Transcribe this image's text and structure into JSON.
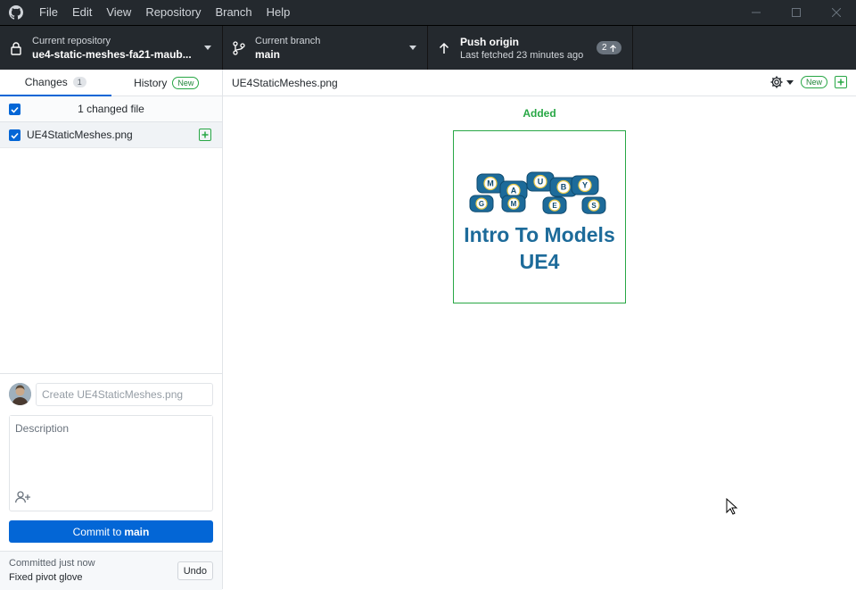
{
  "menu": [
    "File",
    "Edit",
    "View",
    "Repository",
    "Branch",
    "Help"
  ],
  "toolbar": {
    "repo_label": "Current repository",
    "repo_name": "ue4-static-meshes-fa21-maub...",
    "branch_label": "Current branch",
    "branch_name": "main",
    "push_title": "Push origin",
    "push_sub": "Last fetched 23 minutes ago",
    "push_count": "2"
  },
  "tabs": {
    "changes": "Changes",
    "changes_count": "1",
    "history": "History",
    "history_badge": "New"
  },
  "changes": {
    "header": "1 changed file",
    "files": [
      {
        "name": "UE4StaticMeshes.png",
        "status": "added"
      }
    ]
  },
  "commit": {
    "summary_placeholder": "Create UE4StaticMeshes.png",
    "description_placeholder": "Description",
    "button_prefix": "Commit to",
    "button_branch": "main"
  },
  "last_commit": {
    "when": "Committed just now",
    "message": "Fixed pivot glove",
    "undo": "Undo"
  },
  "diff": {
    "file_name": "UE4StaticMeshes.png",
    "new_badge": "New",
    "status_label": "Added"
  },
  "image": {
    "dice_letters": [
      "M",
      "A",
      "U",
      "B",
      "Y",
      "G",
      "M",
      "E",
      "S"
    ],
    "title_line1": "Intro To Models",
    "title_line2": "UE4"
  },
  "colors": {
    "accent_blue": "#0366d6",
    "added_green": "#28a745",
    "toolbar_dark": "#24292e",
    "image_blue": "#1d6b9a"
  }
}
